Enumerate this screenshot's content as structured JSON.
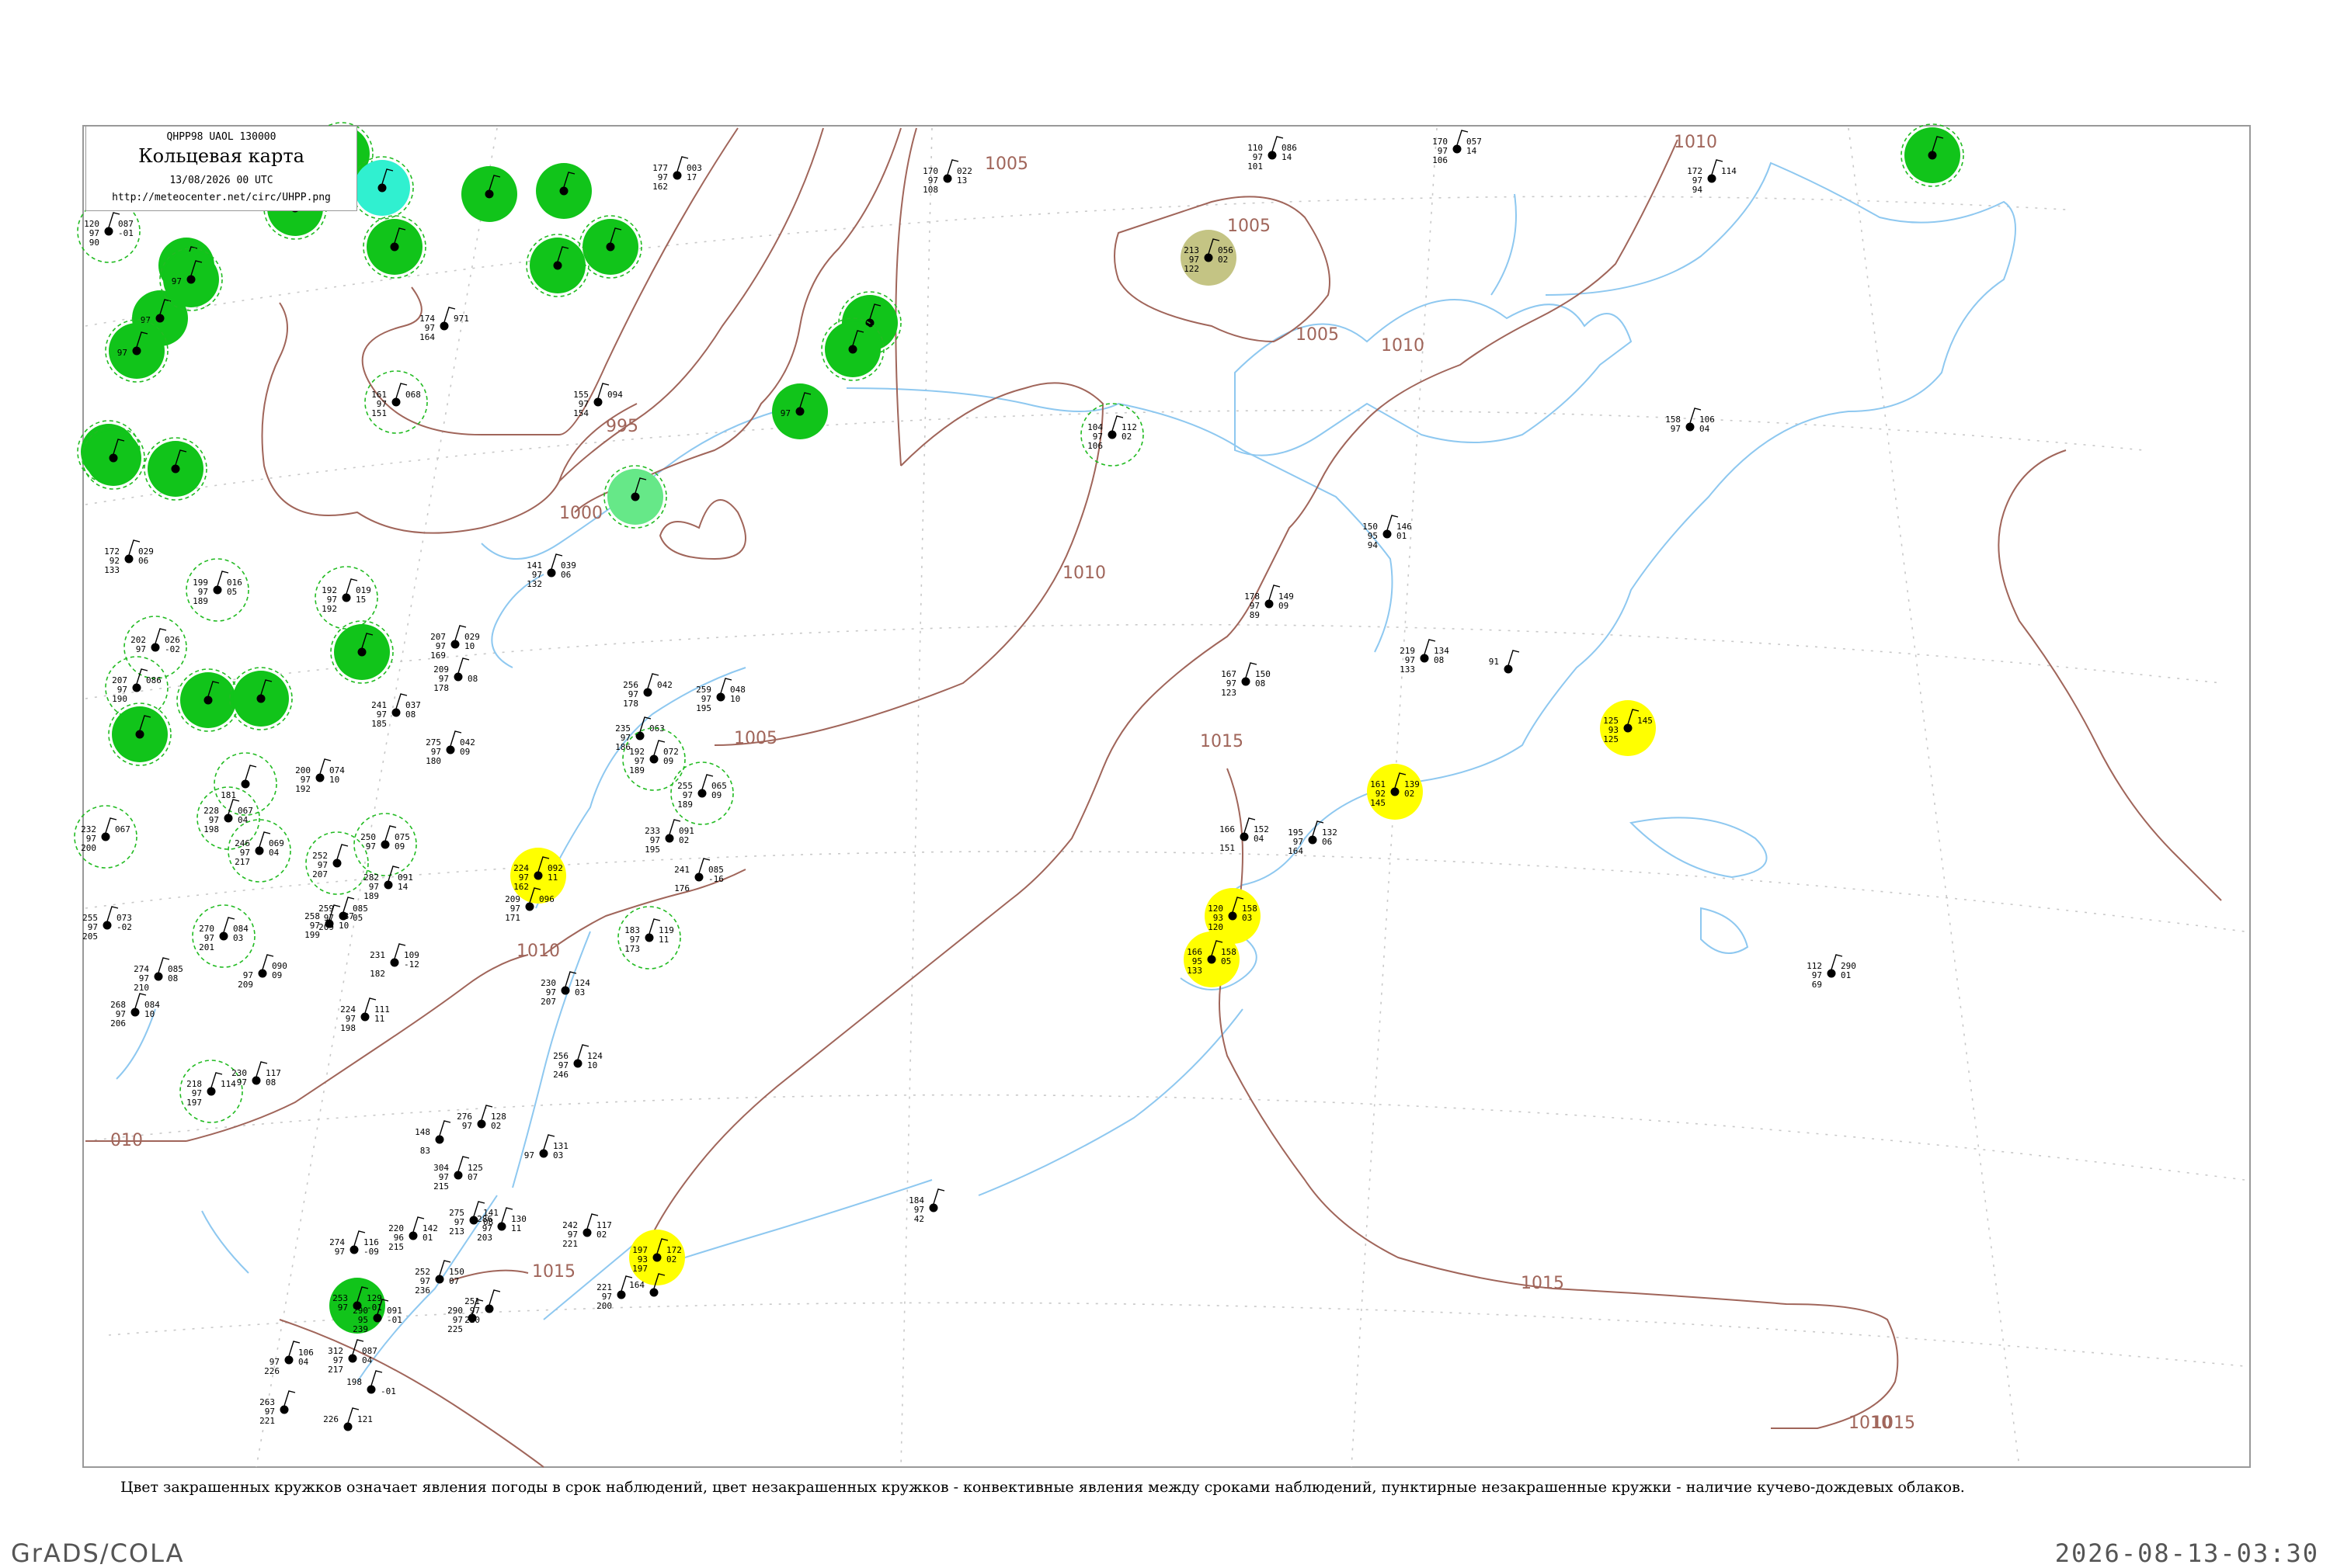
{
  "header": {
    "code": "QHPP98  UAOL  130000",
    "title": "Кольцевая карта",
    "time": "13/08/2026 00 UTC",
    "url": "http://meteocenter.net/circ/UHPP.png"
  },
  "note": "Цвет закрашенных кружков означает явления погоды в срок наблюдений, цвет незакрашенных кружков - конвективные явления между сроками наблюдений, пунктирные незакрашенные кружки - наличие кучево-дождевых облаков.",
  "footer": {
    "left": "GrADS/COLA",
    "right": "2026-08-13-03:30"
  },
  "colors": {
    "isobar": "#a0655a",
    "coast": "#8ec8f0",
    "grid": "#c8c8c8",
    "fog_green": "#11c41a",
    "cyan": "#30f0d0",
    "mint": "#66e888",
    "yellow": "#ffff00",
    "olive": "#c4c484",
    "cb_dash": "#22bb22"
  },
  "isobar_labels": [
    "1005",
    "1005",
    "1005",
    "1010",
    "1010",
    "1000",
    "995",
    "1010",
    "1005",
    "1015",
    "1010",
    "1015",
    "1015",
    "1015",
    "1010",
    "010"
  ],
  "stations": [
    {
      "t": "120",
      "td": "97",
      "p": "087",
      "pt": "-01",
      "v": "90",
      "name": "",
      "c": "none",
      "cb": true
    },
    {
      "t": "",
      "td": "",
      "p": "",
      "pt": "",
      "v": "",
      "name": "",
      "c": "#11c41a",
      "cb": true
    },
    {
      "t": "",
      "td": "",
      "p": "",
      "pt": "",
      "v": "",
      "name": "",
      "c": "#11c41a",
      "cb": true
    },
    {
      "t": "",
      "td": "",
      "p": "",
      "pt": "",
      "v": "",
      "name": "",
      "c": "#11c41a",
      "cb": false
    },
    {
      "t": "",
      "td": "97",
      "p": "",
      "pt": "",
      "v": "",
      "name": "",
      "c": "#11c41a",
      "cb": false
    },
    {
      "t": "",
      "td": "97",
      "p": "",
      "pt": "",
      "v": "",
      "name": "",
      "c": "#11c41a",
      "cb": true
    },
    {
      "t": "",
      "td": "97",
      "p": "",
      "pt": "",
      "v": "",
      "name": "",
      "c": "#11c41a",
      "cb": true
    },
    {
      "t": "",
      "td": "",
      "p": "",
      "pt": "",
      "v": "",
      "name": "",
      "c": "#11c41a",
      "cb": true
    },
    {
      "t": "",
      "td": "",
      "p": "",
      "pt": "",
      "v": "",
      "name": "",
      "c": "#30f0d0",
      "cb": true
    },
    {
      "t": "",
      "td": "",
      "p": "",
      "pt": "",
      "v": "",
      "name": "",
      "c": "#11c41a",
      "cb": true
    },
    {
      "t": "",
      "td": "",
      "p": "",
      "pt": "",
      "v": "",
      "name": "",
      "c": "#11c41a",
      "cb": false
    },
    {
      "t": "",
      "td": "",
      "p": "",
      "pt": "",
      "v": "",
      "name": "",
      "c": "#11c41a",
      "cb": false
    },
    {
      "t": "",
      "td": "",
      "p": "",
      "pt": "",
      "v": "",
      "name": "",
      "c": "#11c41a",
      "cb": true
    },
    {
      "t": "",
      "td": "",
      "p": "",
      "pt": "",
      "v": "",
      "name": "",
      "c": "#11c41a",
      "cb": true
    },
    {
      "t": "174",
      "td": "97",
      "p": "971",
      "pt": "",
      "v": "164",
      "name": "",
      "c": "none",
      "cb": false
    },
    {
      "t": "161",
      "td": "97",
      "p": "068",
      "pt": "",
      "v": "151",
      "name": "",
      "c": "none",
      "cb": true
    },
    {
      "t": "155",
      "td": "97",
      "p": "094",
      "pt": "",
      "v": "154",
      "name": "",
      "c": "none",
      "cb": false
    },
    {
      "t": "",
      "td": "",
      "p": "",
      "pt": "",
      "v": "",
      "name": "",
      "c": "#66e888",
      "cb": true
    },
    {
      "t": "",
      "td": "97",
      "p": "",
      "pt": "",
      "v": "",
      "name": "",
      "c": "#11c41a",
      "cb": false
    },
    {
      "t": "",
      "td": "",
      "p": "",
      "pt": "",
      "v": "",
      "name": "",
      "c": "#11c41a",
      "cb": true
    },
    {
      "t": "",
      "td": "",
      "p": "",
      "pt": "",
      "v": "",
      "name": "",
      "c": "#11c41a",
      "cb": true
    },
    {
      "t": "177",
      "td": "97",
      "p": "003",
      "pt": "17",
      "v": "162",
      "name": "",
      "c": "none",
      "cb": false
    },
    {
      "t": "170",
      "td": "97",
      "p": "022",
      "pt": "13",
      "v": "108",
      "name": "",
      "c": "none",
      "cb": false
    },
    {
      "t": "110",
      "td": "97",
      "p": "086",
      "pt": "14",
      "v": "101",
      "name": "",
      "c": "none",
      "cb": false
    },
    {
      "t": "213",
      "td": "97",
      "p": "056",
      "pt": "02",
      "v": "122",
      "name": "",
      "c": "#c4c484",
      "cb": false
    },
    {
      "t": "170",
      "td": "97",
      "p": "057",
      "pt": "14",
      "v": "106",
      "name": "",
      "c": "none",
      "cb": false
    },
    {
      "t": "172",
      "td": "97",
      "p": "114",
      "pt": "",
      "v": "94",
      "name": "",
      "c": "none",
      "cb": false
    },
    {
      "t": "",
      "td": "",
      "p": "",
      "pt": "",
      "v": "",
      "name": "",
      "c": "#11c41a",
      "cb": true
    },
    {
      "t": "104",
      "td": "97",
      "p": "112",
      "pt": "02",
      "v": "106",
      "name": "",
      "c": "none",
      "cb": true
    },
    {
      "t": "158",
      "td": "97",
      "p": "106",
      "pt": "04",
      "v": "",
      "name": "",
      "c": "none",
      "cb": false
    },
    {
      "t": "150",
      "td": "95",
      "p": "146",
      "pt": "01",
      "v": "94",
      "name": "",
      "c": "none",
      "cb": false
    },
    {
      "t": "178",
      "td": "97",
      "p": "149",
      "pt": "09",
      "v": "89",
      "name": "",
      "c": "none",
      "cb": false
    },
    {
      "t": "167",
      "td": "97",
      "p": "150",
      "pt": "08",
      "v": "123",
      "name": "",
      "c": "none",
      "cb": false
    },
    {
      "t": "219",
      "td": "97",
      "p": "134",
      "pt": "08",
      "v": "133",
      "name": "",
      "c": "none",
      "cb": false
    },
    {
      "t": "91",
      "td": "",
      "p": "",
      "pt": "",
      "v": "",
      "name": "",
      "c": "none",
      "cb": false
    },
    {
      "t": "125",
      "td": "93",
      "p": "145",
      "pt": "",
      "v": "125",
      "name": "",
      "c": "#ffff00",
      "cb": false
    },
    {
      "t": "161",
      "td": "92",
      "p": "139",
      "pt": "02",
      "v": "145",
      "name": "",
      "c": "#ffff00",
      "cb": false
    },
    {
      "t": "166",
      "td": "",
      "p": "152",
      "pt": "04",
      "v": "151",
      "name": "",
      "c": "none",
      "cb": false
    },
    {
      "t": "195",
      "td": "97",
      "p": "132",
      "pt": "06",
      "v": "164",
      "name": "",
      "c": "none",
      "cb": false
    },
    {
      "t": "120",
      "td": "93",
      "p": "158",
      "pt": "03",
      "v": "120",
      "name": "",
      "c": "#ffff00",
      "cb": false
    },
    {
      "t": "166",
      "td": "95",
      "p": "158",
      "pt": "05",
      "v": "133",
      "name": "",
      "c": "#ffff00",
      "cb": false
    },
    {
      "t": "112",
      "td": "97",
      "p": "290",
      "pt": "01",
      "v": "69",
      "name": "",
      "c": "none",
      "cb": false
    },
    {
      "t": "184",
      "td": "97",
      "p": "",
      "pt": "",
      "v": "42",
      "name": "",
      "c": "none",
      "cb": false
    },
    {
      "t": "197",
      "td": "93",
      "p": "172",
      "pt": "02",
      "v": "197",
      "name": "",
      "c": "#ffff00",
      "cb": false
    },
    {
      "t": "164",
      "td": "",
      "p": "",
      "pt": "",
      "v": "",
      "name": "",
      "c": "none",
      "cb": false
    },
    {
      "t": "221",
      "td": "97",
      "p": "",
      "pt": "",
      "v": "200",
      "name": "",
      "c": "none",
      "cb": false
    },
    {
      "t": "224",
      "td": "97",
      "p": "092",
      "pt": "11",
      "v": "162",
      "name": "",
      "c": "#ffff00",
      "cb": false
    },
    {
      "t": "141",
      "td": "97",
      "p": "039",
      "pt": "06",
      "v": "132",
      "name": "",
      "c": "none",
      "cb": false
    },
    {
      "t": "172",
      "td": "92",
      "p": "029",
      "pt": "06",
      "v": "133",
      "name": "",
      "c": "none",
      "cb": false
    },
    {
      "t": "",
      "td": "",
      "p": "",
      "pt": "",
      "v": "",
      "name": "",
      "c": "#11c41a",
      "cb": true
    },
    {
      "t": "",
      "td": "",
      "p": "",
      "pt": "",
      "v": "",
      "name": "",
      "c": "#11c41a",
      "cb": true
    },
    {
      "t": "199",
      "td": "97",
      "p": "016",
      "pt": "05",
      "v": "189",
      "name": "",
      "c": "none",
      "cb": true
    },
    {
      "t": "192",
      "td": "97",
      "p": "019",
      "pt": "15",
      "v": "192",
      "name": "",
      "c": "none",
      "cb": true
    },
    {
      "t": "",
      "td": "",
      "p": "",
      "pt": "",
      "v": "",
      "name": "",
      "c": "#11c41a",
      "cb": true
    },
    {
      "t": "202",
      "td": "97",
      "p": "026",
      "pt": "-02",
      "v": "",
      "name": "",
      "c": "none",
      "cb": true
    },
    {
      "t": "207",
      "td": "97",
      "p": "086",
      "pt": "",
      "v": "190",
      "name": "",
      "c": "none",
      "cb": true
    },
    {
      "t": "",
      "td": "",
      "p": "",
      "pt": "",
      "v": "",
      "name": "",
      "c": "#11c41a",
      "cb": true
    },
    {
      "t": "",
      "td": "",
      "p": "",
      "pt": "",
      "v": "",
      "name": "",
      "c": "#11c41a",
      "cb": true
    },
    {
      "t": "",
      "td": "",
      "p": "",
      "pt": "",
      "v": "",
      "name": "",
      "c": "#11c41a",
      "cb": true
    },
    {
      "t": "207",
      "td": "97",
      "p": "029",
      "pt": "10",
      "v": "169",
      "name": "",
      "c": "none",
      "cb": false
    },
    {
      "t": "209",
      "td": "97",
      "p": "",
      "pt": "08",
      "v": "178",
      "name": "",
      "c": "none",
      "cb": false
    },
    {
      "t": "256",
      "td": "97",
      "p": "042",
      "pt": "",
      "v": "178",
      "name": "",
      "c": "none",
      "cb": false
    },
    {
      "t": "259",
      "td": "97",
      "p": "048",
      "pt": "10",
      "v": "195",
      "name": "",
      "c": "none",
      "cb": false
    },
    {
      "t": "241",
      "td": "97",
      "p": "037",
      "pt": "08",
      "v": "185",
      "name": "",
      "c": "none",
      "cb": false
    },
    {
      "t": "275",
      "td": "97",
      "p": "042",
      "pt": "09",
      "v": "180",
      "name": "",
      "c": "none",
      "cb": false
    },
    {
      "t": "235",
      "td": "97",
      "p": "063",
      "pt": "",
      "v": "186",
      "name": "",
      "c": "none",
      "cb": false
    },
    {
      "t": "192",
      "td": "97",
      "p": "072",
      "pt": "09",
      "v": "189",
      "name": "",
      "c": "none",
      "cb": true
    },
    {
      "t": "255",
      "td": "97",
      "p": "065",
      "pt": "09",
      "v": "189",
      "name": "",
      "c": "none",
      "cb": true
    },
    {
      "t": "200",
      "td": "97",
      "p": "074",
      "pt": "10",
      "v": "192",
      "name": "",
      "c": "none",
      "cb": false
    },
    {
      "t": "",
      "td": "",
      "p": "",
      "pt": "",
      "v": "181",
      "name": "",
      "c": "none",
      "cb": true
    },
    {
      "t": "228",
      "td": "97",
      "p": "067",
      "pt": "04",
      "v": "198",
      "name": "",
      "c": "none",
      "cb": true
    },
    {
      "t": "246",
      "td": "97",
      "p": "069",
      "pt": "04",
      "v": "217",
      "name": "",
      "c": "none",
      "cb": true
    },
    {
      "t": "232",
      "td": "97",
      "p": "067",
      "pt": "",
      "v": "200",
      "name": "",
      "c": "none",
      "cb": true
    },
    {
      "t": "250",
      "td": "97",
      "p": "075",
      "pt": "09",
      "v": "",
      "name": "",
      "c": "none",
      "cb": true
    },
    {
      "t": "252",
      "td": "97",
      "p": "",
      "pt": "",
      "v": "207",
      "name": "",
      "c": "none",
      "cb": true
    },
    {
      "t": "282",
      "td": "97",
      "p": "091",
      "pt": "14",
      "v": "189",
      "name": "",
      "c": "none",
      "cb": false
    },
    {
      "t": "259",
      "td": "97",
      "p": "085",
      "pt": "05",
      "v": "209",
      "name": "",
      "c": "none",
      "cb": false
    },
    {
      "t": "233",
      "td": "97",
      "p": "091",
      "pt": "02",
      "v": "195",
      "name": "",
      "c": "none",
      "cb": false
    },
    {
      "t": "241",
      "td": "",
      "p": "085",
      "pt": "-16",
      "v": "176",
      "name": "",
      "c": "none",
      "cb": false
    },
    {
      "t": "209",
      "td": "97",
      "p": "096",
      "pt": "",
      "v": "171",
      "name": "",
      "c": "none",
      "cb": false
    },
    {
      "t": "183",
      "td": "97",
      "p": "119",
      "pt": "11",
      "v": "173",
      "name": "",
      "c": "none",
      "cb": true
    },
    {
      "t": "255",
      "td": "97",
      "p": "073",
      "pt": "-02",
      "v": "205",
      "name": "",
      "c": "none",
      "cb": false
    },
    {
      "t": "274",
      "td": "97",
      "p": "085",
      "pt": "08",
      "v": "210",
      "name": "",
      "c": "none",
      "cb": false
    },
    {
      "t": "270",
      "td": "97",
      "p": "084",
      "pt": "03",
      "v": "201",
      "name": "",
      "c": "none",
      "cb": true
    },
    {
      "t": "",
      "td": "97",
      "p": "090",
      "pt": "09",
      "v": "209",
      "name": "",
      "c": "none",
      "cb": false
    },
    {
      "t": "258",
      "td": "97",
      "p": "087",
      "pt": "10",
      "v": "199",
      "name": "",
      "c": "none",
      "cb": false
    },
    {
      "t": "231",
      "td": "",
      "p": "109",
      "pt": "-12",
      "v": "182",
      "name": "",
      "c": "none",
      "cb": false
    },
    {
      "t": "268",
      "td": "97",
      "p": "084",
      "pt": "10",
      "v": "206",
      "name": "",
      "c": "none",
      "cb": false
    },
    {
      "t": "224",
      "td": "97",
      "p": "111",
      "pt": "11",
      "v": "198",
      "name": "",
      "c": "none",
      "cb": false
    },
    {
      "t": "230",
      "td": "97",
      "p": "124",
      "pt": "03",
      "v": "207",
      "name": "",
      "c": "none",
      "cb": false
    },
    {
      "t": "256",
      "td": "97",
      "p": "124",
      "pt": "10",
      "v": "246",
      "name": "",
      "c": "none",
      "cb": false
    },
    {
      "t": "218",
      "td": "97",
      "p": "114",
      "pt": "",
      "v": "197",
      "name": "",
      "c": "none",
      "cb": true
    },
    {
      "t": "230",
      "td": "97",
      "p": "117",
      "pt": "08",
      "v": "",
      "name": "",
      "c": "none",
      "cb": false
    },
    {
      "t": "276",
      "td": "97",
      "p": "128",
      "pt": "02",
      "v": "",
      "name": "",
      "c": "none",
      "cb": false
    },
    {
      "t": "148",
      "td": "",
      "p": "",
      "pt": "",
      "v": "83",
      "name": "",
      "c": "none",
      "cb": false
    },
    {
      "t": "",
      "td": "97",
      "p": "131",
      "pt": "03",
      "v": "",
      "name": "",
      "c": "none",
      "cb": false
    },
    {
      "t": "304",
      "td": "97",
      "p": "125",
      "pt": "07",
      "v": "215",
      "name": "",
      "c": "none",
      "cb": false
    },
    {
      "t": "286",
      "td": "97",
      "p": "130",
      "pt": "11",
      "v": "203",
      "name": "",
      "c": "none",
      "cb": false
    },
    {
      "t": "275",
      "td": "97",
      "p": "141",
      "pt": "08",
      "v": "213",
      "name": "",
      "c": "none",
      "cb": false
    },
    {
      "t": "242",
      "td": "97",
      "p": "117",
      "pt": "02",
      "v": "221",
      "name": "",
      "c": "none",
      "cb": false
    },
    {
      "t": "274",
      "td": "97",
      "p": "116",
      "pt": "-09",
      "v": "",
      "name": "",
      "c": "none",
      "cb": false
    },
    {
      "t": "220",
      "td": "96",
      "p": "142",
      "pt": "01",
      "v": "215",
      "name": "",
      "c": "none",
      "cb": false
    },
    {
      "t": "252",
      "td": "97",
      "p": "150",
      "pt": "07",
      "v": "236",
      "name": "",
      "c": "none",
      "cb": false
    },
    {
      "t": "251",
      "td": "97",
      "p": "",
      "pt": "",
      "v": "220",
      "name": "",
      "c": "none",
      "cb": false
    },
    {
      "t": "290",
      "td": "97",
      "p": "",
      "pt": "",
      "v": "225",
      "name": "",
      "c": "none",
      "cb": false
    },
    {
      "t": "253",
      "td": "97",
      "p": "129",
      "pt": "-01",
      "v": "",
      "name": "",
      "c": "#11c41a",
      "cb": false
    },
    {
      "t": "290",
      "td": "95",
      "p": "091",
      "pt": "-01",
      "v": "239",
      "name": "",
      "c": "none",
      "cb": false
    },
    {
      "t": "",
      "td": "97",
      "p": "106",
      "pt": "04",
      "v": "226",
      "name": "",
      "c": "none",
      "cb": false
    },
    {
      "t": "312",
      "td": "97",
      "p": "087",
      "pt": "04",
      "v": "217",
      "name": "",
      "c": "none",
      "cb": false
    },
    {
      "t": "263",
      "td": "97",
      "p": "",
      "pt": "",
      "v": "221",
      "name": "",
      "c": "none",
      "cb": false
    },
    {
      "t": "226",
      "td": "",
      "p": "121",
      "pt": "",
      "v": "",
      "name": "",
      "c": "none",
      "cb": false
    },
    {
      "t": "198",
      "td": "",
      "p": "",
      "pt": "-01",
      "v": "",
      "name": "",
      "c": "none",
      "cb": false
    }
  ]
}
